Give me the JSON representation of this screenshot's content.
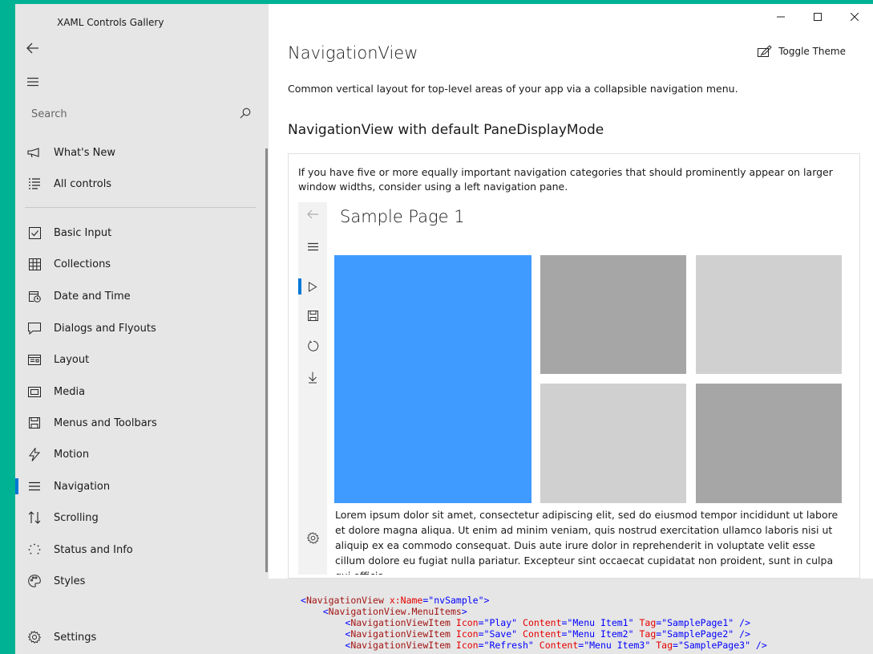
{
  "app": {
    "title": "XAML Controls Gallery"
  },
  "search": {
    "placeholder": "Search"
  },
  "sidebar": {
    "items": [
      {
        "label": "What's New",
        "icon": "megaphone-icon"
      },
      {
        "label": "All controls",
        "icon": "list-icon"
      },
      {
        "label": "Basic Input",
        "icon": "checkbox-icon"
      },
      {
        "label": "Collections",
        "icon": "grid-icon"
      },
      {
        "label": "Date and Time",
        "icon": "calendar-clock-icon"
      },
      {
        "label": "Dialogs and Flyouts",
        "icon": "speech-bubble-icon"
      },
      {
        "label": "Layout",
        "icon": "layout-icon"
      },
      {
        "label": "Media",
        "icon": "media-icon"
      },
      {
        "label": "Menus and Toolbars",
        "icon": "save-icon"
      },
      {
        "label": "Motion",
        "icon": "lightning-icon"
      },
      {
        "label": "Navigation",
        "icon": "hamburger-icon"
      },
      {
        "label": "Scrolling",
        "icon": "sort-arrows-icon"
      },
      {
        "label": "Status and Info",
        "icon": "progress-ring-icon"
      },
      {
        "label": "Styles",
        "icon": "palette-icon"
      }
    ],
    "settings_label": "Settings",
    "selected": "Navigation"
  },
  "header": {
    "title": "NavigationView",
    "toggle_theme": "Toggle Theme",
    "description": "Common vertical layout for top-level areas of your app via a collapsible navigation menu."
  },
  "example": {
    "title": "NavigationView with default PaneDisplayMode",
    "description": "If you have five or more equally important navigation categories that should prominently appear on larger window widths, consider using a left navigation pane.",
    "sample_title": "Sample Page 1",
    "lorem": "Lorem ipsum dolor sit amet, consectetur adipiscing elit, sed do eiusmod tempor incididunt ut labore et dolore magna aliqua. Ut enim ad minim veniam, quis nostrud exercitation ullamco laboris nisi ut aliquip ex ea commodo consequat. Duis aute irure dolor in reprehenderit in voluptate velit esse cillum dolore eu fugiat nulla pariatur. Excepteur sint occaecat cupidatat non proident, sunt in culpa qui officia",
    "tile_colors": [
      "#3f9bff",
      "#a6a6a6",
      "#d0d0d0",
      "#d0d0d0",
      "#a6a6a6"
    ]
  },
  "code": {
    "line1": {
      "tag": "NavigationView",
      "attr": "x:Name",
      "val": "nvSample"
    },
    "line2": {
      "tag": "NavigationView.MenuItems"
    },
    "items": [
      {
        "icon": "Play",
        "content": "Menu Item1",
        "tag": "SamplePage1"
      },
      {
        "icon": "Save",
        "content": "Menu Item2",
        "tag": "SamplePage2"
      },
      {
        "icon": "Refresh",
        "content": "Menu Item3",
        "tag": "SamplePage3"
      }
    ]
  },
  "colors": {
    "accent": "#0078d7",
    "titlebar": "#00b294"
  }
}
